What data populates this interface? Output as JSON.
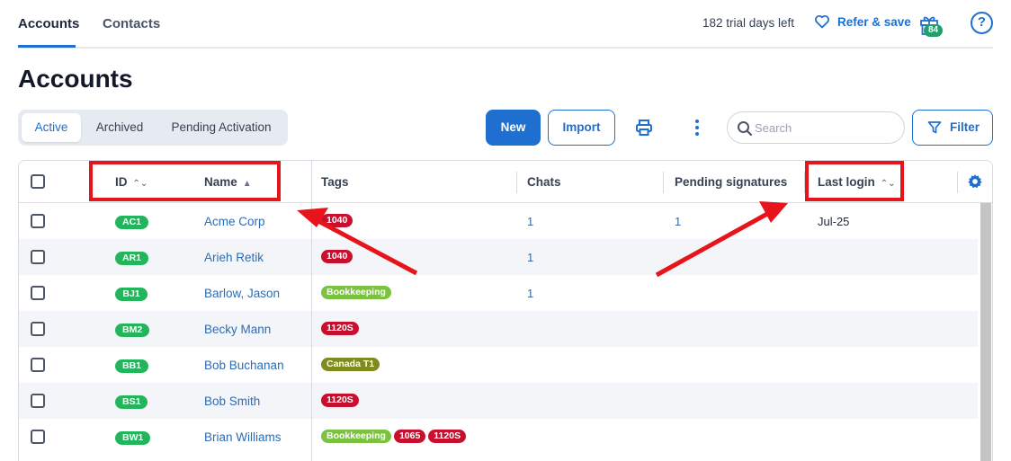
{
  "topnav": {
    "tabs": [
      {
        "label": "Accounts",
        "active": true
      },
      {
        "label": "Contacts",
        "active": false
      }
    ],
    "trial_text": "182 trial days left",
    "refer_label": "Refer & save",
    "gift_count": "84",
    "help_symbol": "?"
  },
  "page": {
    "title": "Accounts"
  },
  "status_tabs": [
    {
      "label": "Active",
      "active": true
    },
    {
      "label": "Archived",
      "active": false
    },
    {
      "label": "Pending Activation",
      "active": false
    }
  ],
  "toolbar": {
    "new_label": "New",
    "import_label": "Import",
    "search_placeholder": "Search",
    "filter_label": "Filter"
  },
  "table": {
    "columns": {
      "id": "ID",
      "name": "Name",
      "tags": "Tags",
      "chats": "Chats",
      "pending_signatures": "Pending signatures",
      "last_login": "Last login"
    },
    "rows": [
      {
        "id": "AC1",
        "name": "Acme Corp",
        "tags": [
          {
            "label": "1040",
            "color": "#c8102e"
          }
        ],
        "chats": "1",
        "pending": "1",
        "last_login": "Jul-25"
      },
      {
        "id": "AR1",
        "name": "Arieh Retik",
        "tags": [
          {
            "label": "1040",
            "color": "#c8102e"
          }
        ],
        "chats": "1",
        "pending": "",
        "last_login": ""
      },
      {
        "id": "BJ1",
        "name": "Barlow, Jason",
        "tags": [
          {
            "label": "Bookkeeping",
            "color": "#7cc242"
          }
        ],
        "chats": "1",
        "pending": "",
        "last_login": ""
      },
      {
        "id": "BM2",
        "name": "Becky Mann",
        "tags": [
          {
            "label": "1120S",
            "color": "#c8102e"
          }
        ],
        "chats": "",
        "pending": "",
        "last_login": ""
      },
      {
        "id": "BB1",
        "name": "Bob Buchanan",
        "tags": [
          {
            "label": "Canada T1",
            "color": "#7f8c1d"
          }
        ],
        "chats": "",
        "pending": "",
        "last_login": ""
      },
      {
        "id": "BS1",
        "name": "Bob Smith",
        "tags": [
          {
            "label": "1120S",
            "color": "#c8102e"
          }
        ],
        "chats": "",
        "pending": "",
        "last_login": ""
      },
      {
        "id": "BW1",
        "name": "Brian Williams",
        "tags": [
          {
            "label": "Bookkeeping",
            "color": "#7cc242"
          },
          {
            "label": "1065",
            "color": "#c8102e"
          },
          {
            "label": "1120S",
            "color": "#c8102e"
          }
        ],
        "chats": "",
        "pending": "",
        "last_login": ""
      }
    ]
  },
  "colors": {
    "accent": "#1e6fd0",
    "id_badge": "#22b55c",
    "annotation": "#e8141b"
  }
}
